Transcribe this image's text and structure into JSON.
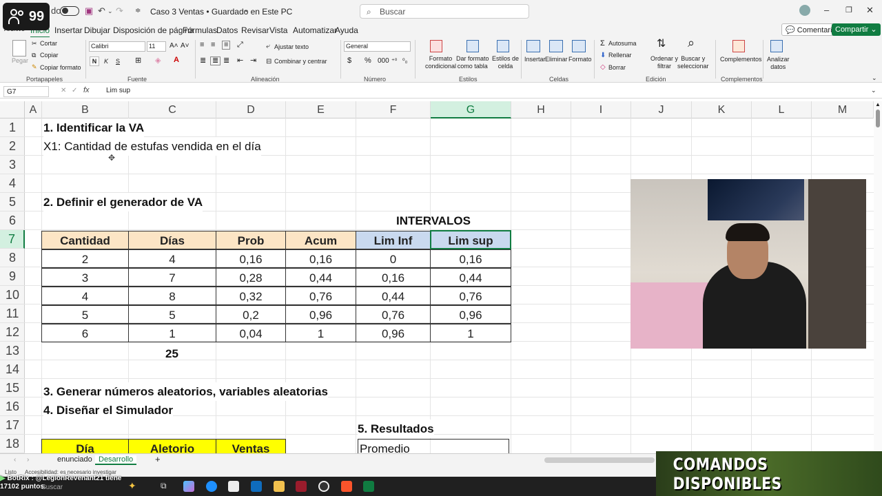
{
  "viewer_count": "99",
  "titlebar": {
    "autosave_label": "do",
    "document_title": "Caso 3 Ventas • Guardado en Este PC",
    "search_placeholder": "Buscar"
  },
  "menu": {
    "tabs": [
      "Archivo",
      "Inicio",
      "Insertar",
      "Dibujar",
      "Disposición de página",
      "Fórmulas",
      "Datos",
      "Revisar",
      "Vista",
      "Automatizar",
      "Ayuda"
    ],
    "active_tab": "Inicio",
    "comments_label": "Comentarios",
    "share_label": "Compartir"
  },
  "ribbon": {
    "paste": "Pegar",
    "cut": "Cortar",
    "copy": "Copiar",
    "format_painter": "Copiar formato",
    "clipboard_group": "Portapapeles",
    "font_name": "Calibri",
    "font_size": "11",
    "bold": "N",
    "italic": "K",
    "underline": "S",
    "font_group": "Fuente",
    "wrap_text": "Ajustar texto",
    "merge_center": "Combinar y centrar",
    "alignment_group": "Alineación",
    "number_format": "General",
    "number_group": "Número",
    "conditional_format": [
      "Formato",
      "condicional"
    ],
    "format_as_table": [
      "Dar formato",
      "como tabla"
    ],
    "cell_styles": [
      "Estilos de",
      "celda"
    ],
    "styles_group": "Estilos",
    "insert": "Insertar",
    "delete": "Eliminar",
    "format": "Formato",
    "cells_group": "Celdas",
    "autosum": "Autosuma",
    "fill": "Rellenar",
    "clear": "Borrar",
    "sort_filter": [
      "Ordenar y",
      "filtrar"
    ],
    "find_select": [
      "Buscar y",
      "seleccionar"
    ],
    "editing_group": "Edición",
    "addins": "Complementos",
    "addins_group": "Complementos",
    "analyze_data": [
      "Analizar",
      "datos"
    ]
  },
  "formula_bar": {
    "name_box": "G7",
    "fx": "fx",
    "formula": "Lim sup"
  },
  "columns": [
    "A",
    "B",
    "C",
    "D",
    "E",
    "F",
    "G",
    "H",
    "I",
    "J",
    "K",
    "L",
    "M"
  ],
  "rows": [
    "1",
    "2",
    "3",
    "4",
    "5",
    "6",
    "7",
    "8",
    "9",
    "10",
    "11",
    "12",
    "13",
    "14",
    "15",
    "16",
    "17",
    "18"
  ],
  "sheet": {
    "r1": "1. Identificar la VA",
    "r2": "X1: Cantidad de estufas vendida en el día",
    "r5": "2. Definir el generador de VA",
    "intervals_title": "INTERVALOS",
    "table_headers": [
      "Cantidad",
      "Días",
      "Prob",
      "Acum",
      "Lim Inf",
      "Lim sup"
    ],
    "table_rows": [
      [
        "2",
        "4",
        "0,16",
        "0,16",
        "0",
        "0,16"
      ],
      [
        "3",
        "7",
        "0,28",
        "0,44",
        "0,16",
        "0,44"
      ],
      [
        "4",
        "8",
        "0,32",
        "0,76",
        "0,44",
        "0,76"
      ],
      [
        "5",
        "5",
        "0,2",
        "0,96",
        "0,76",
        "0,96"
      ],
      [
        "6",
        "1",
        "0,04",
        "1",
        "0,96",
        "1"
      ]
    ],
    "total_days": "25",
    "r15": "3.  Generar números aleatorios, variables aleatorias",
    "r16": "4. Diseñar el Simulador",
    "results_title": "5. Resultados",
    "sim_headers": [
      "Día",
      "Aletorio",
      "Ventas"
    ],
    "average_label": "Promedio"
  },
  "sheets": [
    "enunciado",
    "Desarrollo"
  ],
  "active_sheet": "Desarrollo",
  "add_sheet": "+",
  "status": {
    "ready": "Listo",
    "accessibility": "Accesibilidad: es necesario investigar"
  },
  "taskbar": {
    "search": "Buscar"
  },
  "overlay": {
    "botrix_line1": "BotRix : @LegionRevenant21 tiene",
    "botrix_line2": "17102 puntos.",
    "commands": "COMANDOS DISPONIBLES"
  },
  "colors": {
    "excel_green": "#107c41",
    "header_orange": "#fce5c5",
    "header_blue": "#c9d9ef",
    "highlight_yellow": "#ffff00"
  }
}
